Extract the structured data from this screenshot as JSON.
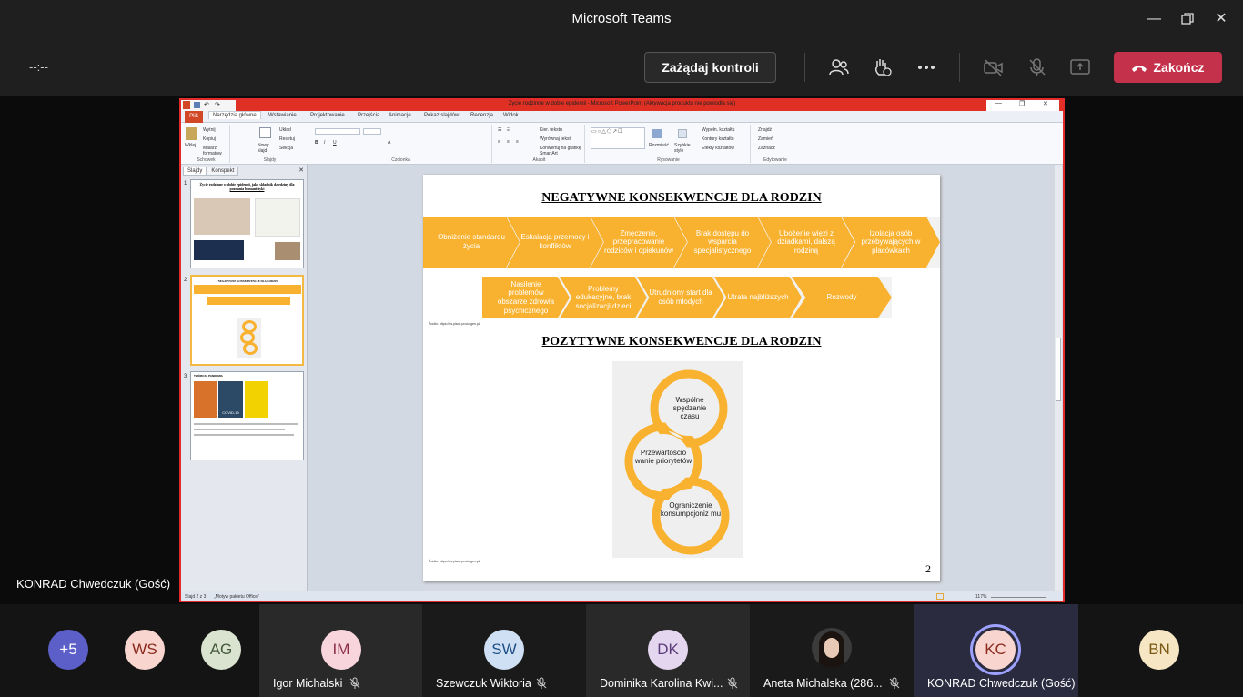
{
  "window": {
    "title": "Microsoft Teams"
  },
  "toolbar": {
    "timer": "--:--",
    "request_control": "Zażądaj kontroli",
    "end_call": "Zakończ",
    "colors": {
      "end": "#c4314b"
    }
  },
  "presenter": {
    "name": "KONRAD Chwedczuk (Gość)"
  },
  "ppt": {
    "window_title": "Życie rodzinne w dobie epidemii - Microsoft PowerPoint (Aktywacja produktu nie powiodła się)",
    "file_tab": "Plik",
    "tabs": [
      "Narzędzia główne",
      "Wstawianie",
      "Projektowanie",
      "Przejścia",
      "Animacje",
      "Pokaz slajdów",
      "Recenzja",
      "Widok"
    ],
    "groups": [
      "Schowek",
      "Slajdy",
      "Czcionka",
      "Akapit",
      "Rysowanie",
      "Edytowanie"
    ],
    "ribbon_text": {
      "paste": "Wklej",
      "cut": "Wytnij",
      "copy": "Kopiuj",
      "format": "Malarz formatów",
      "new_slide": "Nowy slajd",
      "layout": "Układ",
      "reset": "Resetuj",
      "section": "Sekcja",
      "text_dir": "Kier. tekstu",
      "align_text": "Wyrównaj tekst",
      "smartart": "Konwertuj na grafikę SmartArt",
      "arrange": "Rozmieść",
      "quick_styles": "Szybkie style",
      "shape_fill": "Wypełn. kształtu",
      "shape_outline": "Kontury kształtu",
      "shape_effects": "Efekty kształtów",
      "find": "Znajdź",
      "replace": "Zamień",
      "select": "Zaznacz"
    },
    "panel_tabs": [
      "Slajdy",
      "Konspekt"
    ],
    "status_left": "Slajd 2 z 3",
    "status_theme": "„Motyw pakietu Office\"",
    "zoom": "117%"
  },
  "thumbnails": [
    {
      "num": "1",
      "title": "Życie rodzinne w dobie epidemii, jako składnik dziedziny dla poznania humanistyki"
    },
    {
      "num": "2",
      "title": "NEGATYWNE KONSEKWENCJE DLA RODZIN"
    },
    {
      "num": "3",
      "title": "TWÓRCZA PANDEMIA",
      "sub": "COVID-19"
    }
  ],
  "slide": {
    "heading_negative": "NEGATYWNE KONSEKWENCJE DLA RODZIN",
    "row1": [
      "Obniżenie standardu życia",
      "Eskalacja przemocy i konfliktów",
      "Zmęczenie, przepracowanie rodziców i opiekunów",
      "Brak dostępu do wsparcia specjalistycznego",
      "Ubożenie więzi z dziadkami, dalszą rodziną",
      "Izolacja osób przebywających w placówkach"
    ],
    "row2": [
      "Nasilenie problemów obszarze zdrowia psychicznego",
      "Problemy edukacyjne, brak socjalizacji dzieci",
      "Utrudniony start dla osób młodych",
      "Utrata najbliższych",
      "Rozwody"
    ],
    "source1": "Źródło: https://us.plsoft.pro/ucgen.pl/",
    "heading_positive": "POZYTYWNE KONSEKWENCJE DLA RODZIN",
    "cycle": [
      "Wspólne spędzanie czasu",
      "Przewartościo wanie priorytetów",
      "Ograniczenie konsumpcjoniz mu"
    ],
    "source2": "Źródło: https://us.plsoft.pro/ucgen.pl/",
    "page_number": "2",
    "colors": {
      "accent": "#f8b230"
    }
  },
  "participants": [
    {
      "initials": "+5",
      "bg": "#5b5fc7",
      "fg": "#ffffff"
    },
    {
      "initials": "WS",
      "bg": "#f9d5cf",
      "fg": "#8b2b1f"
    },
    {
      "initials": "AG",
      "bg": "#d9e3cf",
      "fg": "#44583a"
    },
    {
      "initials": "IM",
      "bg": "#f8d4dc",
      "fg": "#8d2f48",
      "name": "Igor Michalski"
    },
    {
      "initials": "SW",
      "bg": "#cfe0f4",
      "fg": "#1f4e85",
      "name": "Szewczuk Wiktoria"
    },
    {
      "initials": "DK",
      "bg": "#e4d6ef",
      "fg": "#5c3b7a",
      "name": "Dominika Karolina Kwi..."
    },
    {
      "initials": "",
      "bg": "#3b3b3b",
      "fg": "#ffffff",
      "name": "Aneta Michalska (286..."
    },
    {
      "initials": "KC",
      "bg": "#f9d5cf",
      "fg": "#8b2b1f",
      "name": "KONRAD Chwedczuk (Gość)"
    },
    {
      "initials": "BN",
      "bg": "#f6e6c3",
      "fg": "#7a5a14"
    }
  ]
}
